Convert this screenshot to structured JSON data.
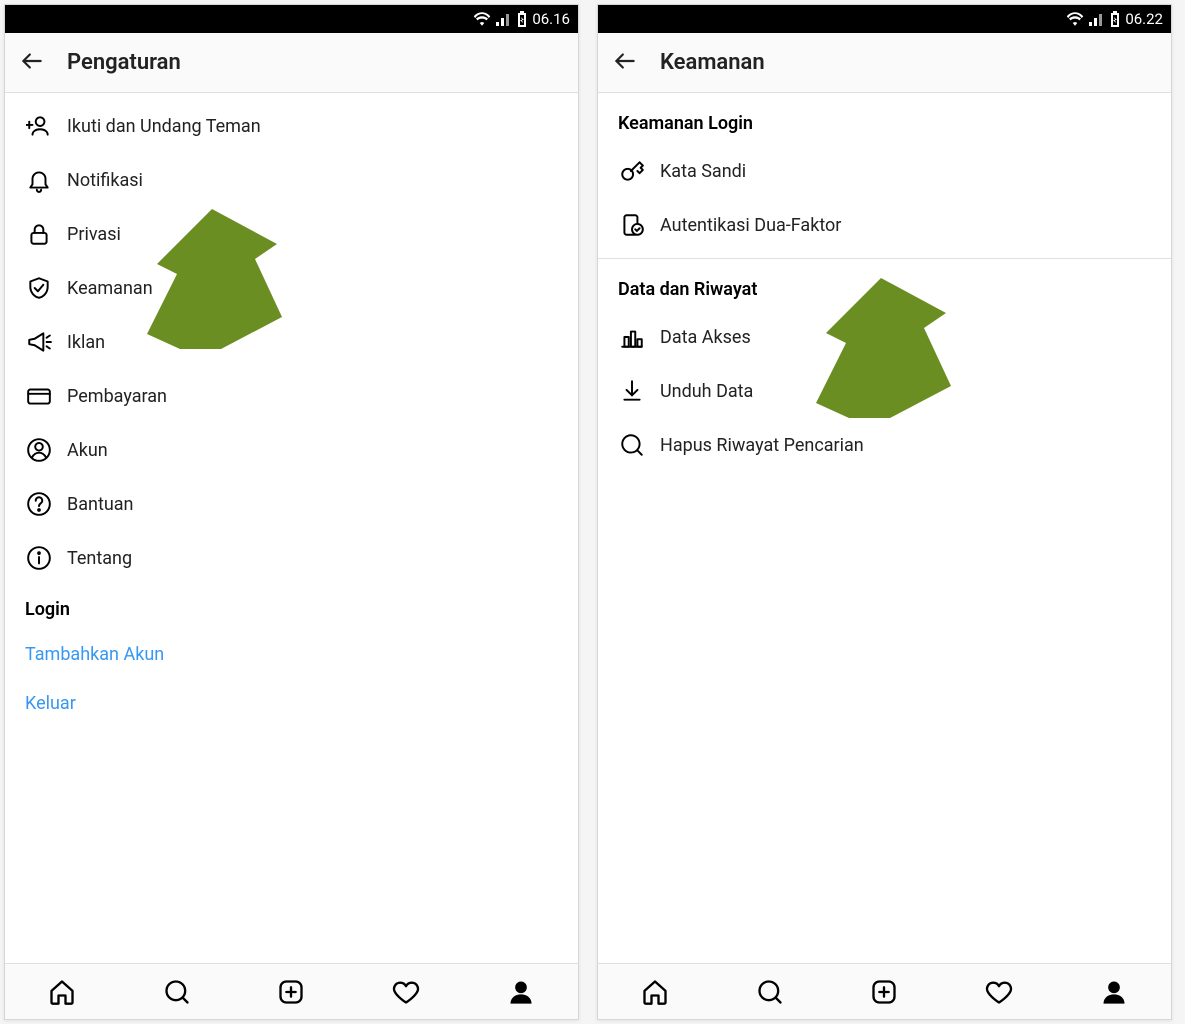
{
  "colors": {
    "arrow": "#6b8e23",
    "link": "#3897f0"
  },
  "left": {
    "statusbar": {
      "time": "06.16"
    },
    "header": {
      "title": "Pengaturan"
    },
    "items": [
      {
        "icon": "invite",
        "label": "Ikuti dan Undang Teman"
      },
      {
        "icon": "bell",
        "label": "Notifikasi"
      },
      {
        "icon": "lock",
        "label": "Privasi"
      },
      {
        "icon": "shield",
        "label": "Keamanan"
      },
      {
        "icon": "megaphone",
        "label": "Iklan"
      },
      {
        "icon": "card",
        "label": "Pembayaran"
      },
      {
        "icon": "person",
        "label": "Akun"
      },
      {
        "icon": "help",
        "label": "Bantuan"
      },
      {
        "icon": "info",
        "label": "Tentang"
      }
    ],
    "section": {
      "title": "Login"
    },
    "links": [
      {
        "label": "Tambahkan Akun"
      },
      {
        "label": "Keluar"
      }
    ]
  },
  "right": {
    "statusbar": {
      "time": "06.22"
    },
    "header": {
      "title": "Keamanan"
    },
    "section1": {
      "title": "Keamanan Login"
    },
    "items1": [
      {
        "icon": "key",
        "label": "Kata Sandi"
      },
      {
        "icon": "twofa",
        "label": "Autentikasi Dua-Faktor"
      }
    ],
    "section2": {
      "title": "Data dan Riwayat"
    },
    "items2": [
      {
        "icon": "chart",
        "label": "Data Akses"
      },
      {
        "icon": "download",
        "label": "Unduh Data"
      },
      {
        "icon": "search",
        "label": "Hapus Riwayat Pencarian"
      }
    ]
  }
}
